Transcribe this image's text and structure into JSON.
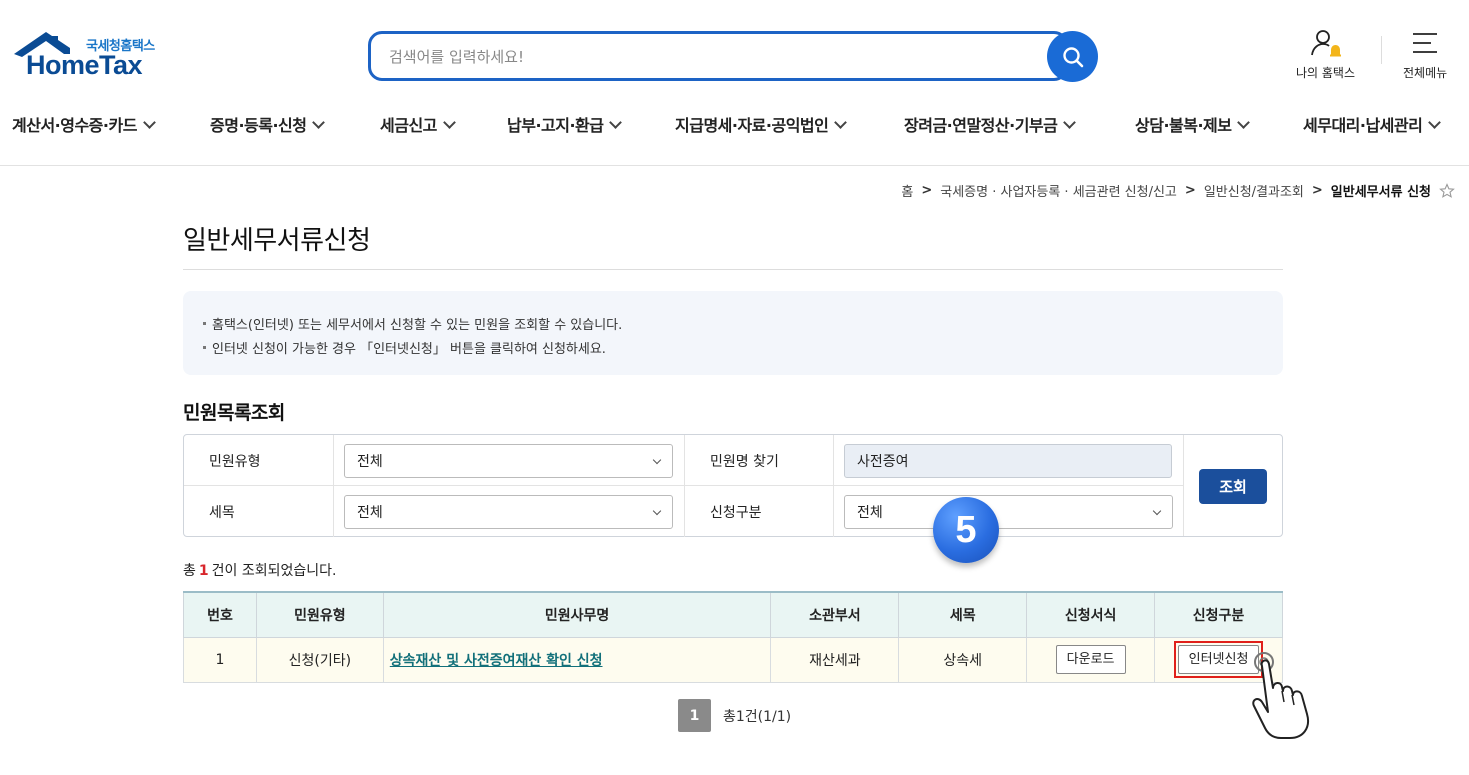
{
  "header": {
    "logo_sub": "국세청홈택스",
    "logo_main": "HomeTax",
    "search_placeholder": "검색어를 입력하세요!",
    "my_hometax": "나의 홈택스",
    "all_menu": "전체메뉴"
  },
  "gnb": [
    "계산서·영수증·카드",
    "증명·등록·신청",
    "세금신고",
    "납부·고지·환급",
    "지급명세·자료·공익법인",
    "장려금·연말정산·기부금",
    "상담·불복·제보",
    "세무대리·납세관리"
  ],
  "breadcrumb": [
    "홈",
    "국세증명 · 사업자등록 · 세금관련 신청/신고",
    "일반신청/결과조회",
    "일반세무서류 신청"
  ],
  "breadcrumb_sep": ">",
  "page_title": "일반세무서류신청",
  "info": [
    "홈택스(인터넷) 또는 세무서에서 신청할 수 있는 민원을 조회할 수 있습니다.",
    "인터넷 신청이 가능한 경우 「인터넷신청」 버튼을 클릭하여 신청하세요."
  ],
  "section_title": "민원목록조회",
  "form": {
    "type_label": "민원유형",
    "type_value": "전체",
    "name_label": "민원명 찾기",
    "name_value": "사전증여",
    "tax_label": "세목",
    "tax_value": "전체",
    "req_label": "신청구분",
    "req_value": "전체",
    "submit": "조회"
  },
  "step_badge": "5",
  "result": {
    "prefix": "총",
    "count": "1",
    "suffix": "건이 조회되었습니다."
  },
  "table": {
    "headers": [
      "번호",
      "민원유형",
      "민원사무명",
      "소관부서",
      "세목",
      "신청서식",
      "신청구분"
    ],
    "rows": [
      {
        "no": "1",
        "type": "신청(기타)",
        "name": "상속재산 및 사전증여재산 확인 신청",
        "dept": "재산세과",
        "tax": "상속세",
        "form_btn": "다운로드",
        "apply_btn": "인터넷신청"
      }
    ]
  },
  "pager": {
    "current": "1",
    "summary": "총1건(1/1)"
  },
  "colors": {
    "primary": "#1b4f9c",
    "search_border": "#1d63c5",
    "highlight": "#e0201a",
    "count_red": "#d8262c"
  }
}
